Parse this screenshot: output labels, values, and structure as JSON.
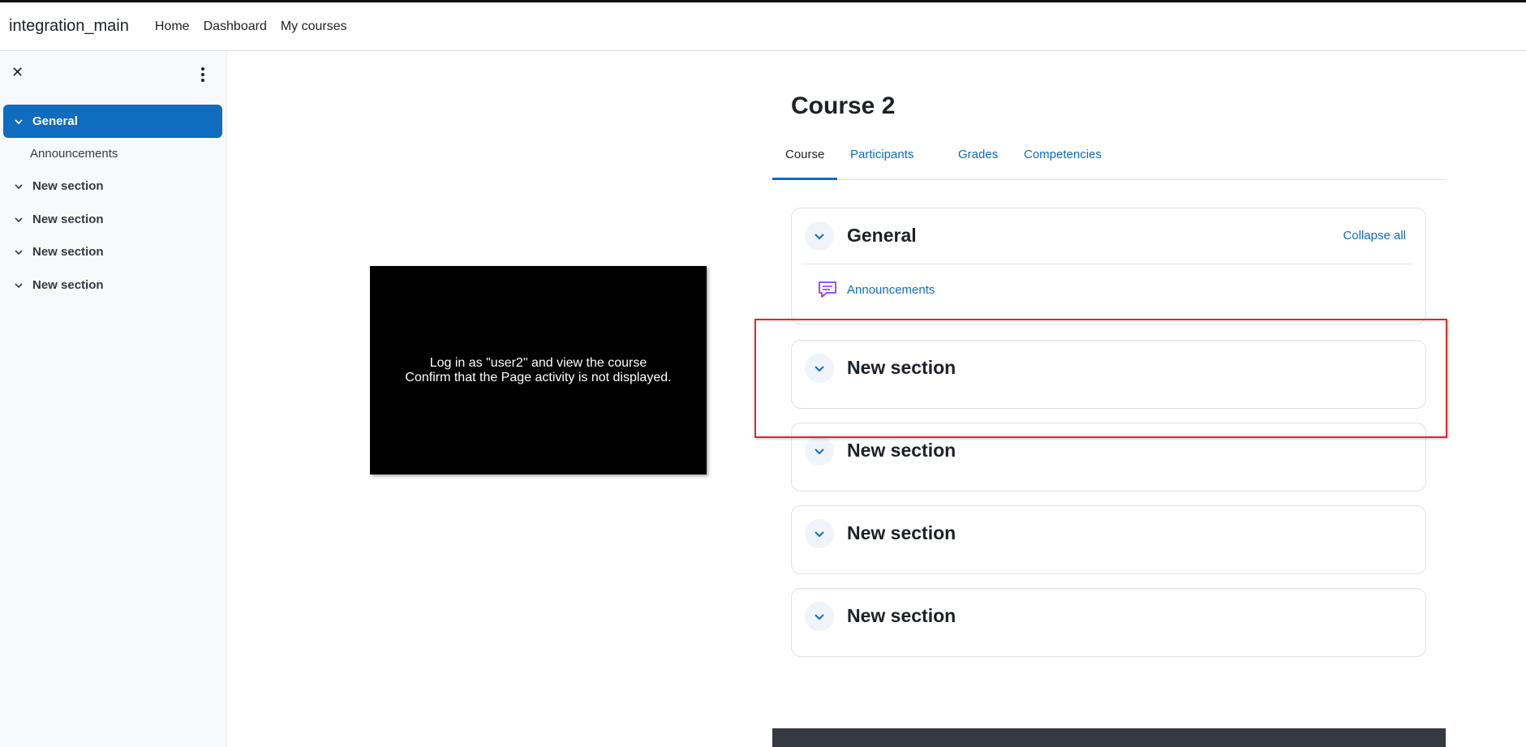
{
  "topbar": {
    "brand": "integration_main",
    "nav": [
      "Home",
      "Dashboard",
      "My courses"
    ]
  },
  "drawer": {
    "items": [
      {
        "label": "General",
        "active": true
      },
      {
        "label": "Announcements",
        "sub": true
      },
      {
        "label": "New section"
      },
      {
        "label": "New section"
      },
      {
        "label": "New section"
      },
      {
        "label": "New section"
      }
    ]
  },
  "video": {
    "line1": "Log in as \"user2\" and view the course",
    "line2": "Confirm that the Page activity is not displayed."
  },
  "course": {
    "title": "Course 2",
    "tabs": [
      "Course",
      "Participants",
      "Grades",
      "Competencies"
    ],
    "active_tab": "Course",
    "collapse_all": "Collapse all",
    "sections": [
      {
        "title": "General",
        "activities": [
          "Announcements"
        ]
      },
      {
        "title": "New section"
      },
      {
        "title": "New section"
      },
      {
        "title": "New section"
      },
      {
        "title": "New section"
      }
    ]
  },
  "colors": {
    "brand": "#0f6cbf",
    "highlight": "#e0262a",
    "forum_icon": "#8a3ffc"
  }
}
